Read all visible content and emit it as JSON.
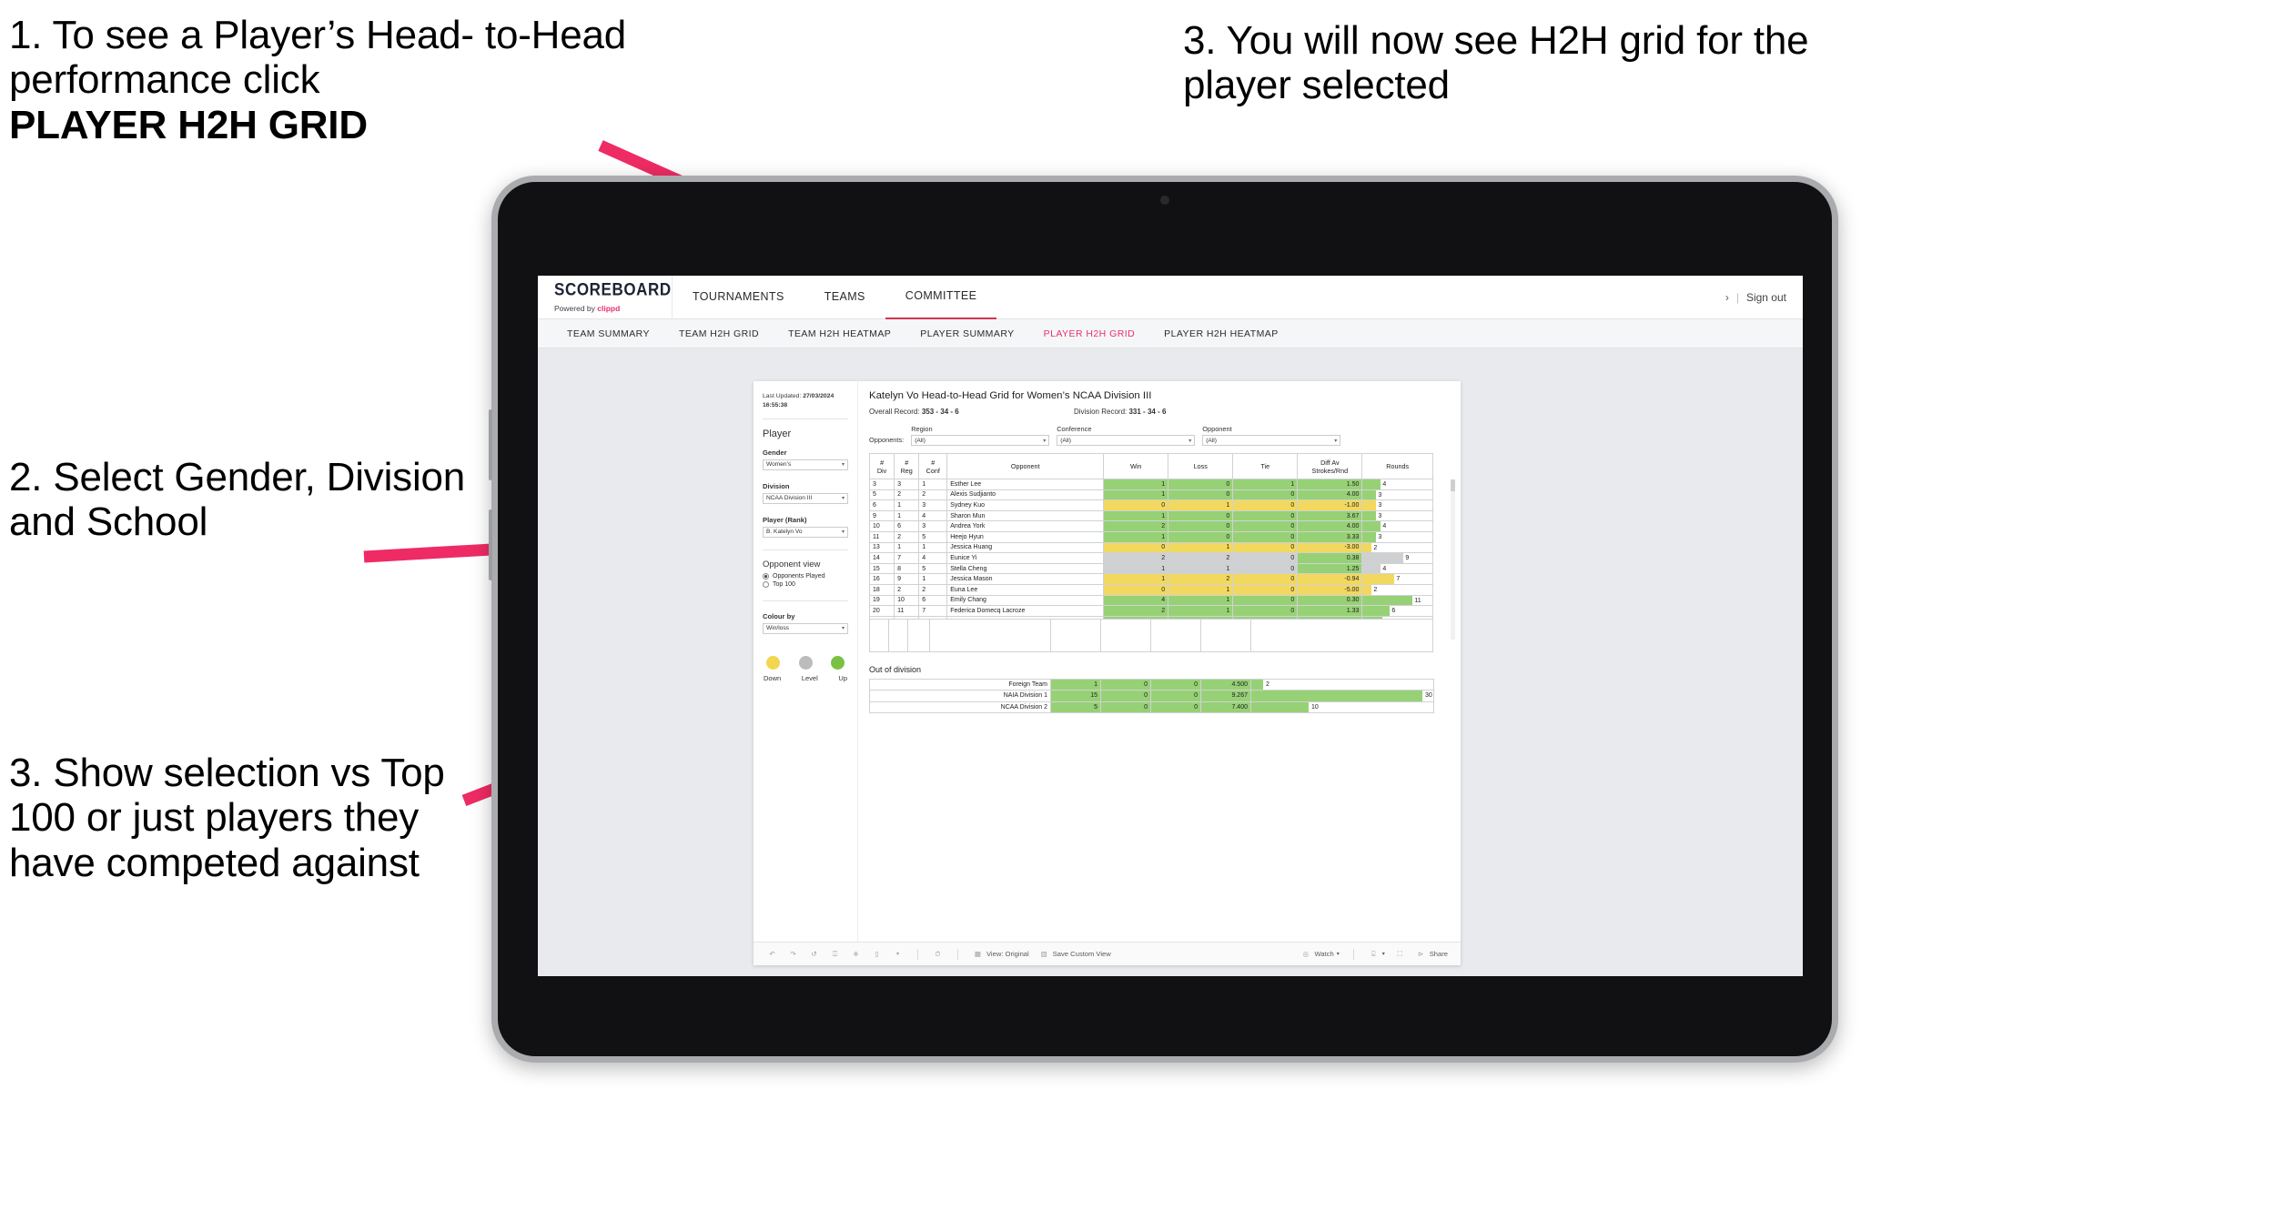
{
  "annotations": {
    "a1_line1": "1. To see a Player’s Head-",
    "a1_line2": "to-Head performance click",
    "a1_bold": "PLAYER H2H GRID",
    "a2": "2. Select Gender, Division and School",
    "a3": "3. Show selection vs Top 100 or just players they have competed against",
    "a4": "3. You will now see H2H grid for the player selected"
  },
  "app": {
    "brand": {
      "name": "SCOREBOARD",
      "sub_prefix": "Powered by ",
      "sub_accent": "clippd"
    },
    "topnav": [
      {
        "label": "TOURNAMENTS",
        "active": false
      },
      {
        "label": "TEAMS",
        "active": false
      },
      {
        "label": "COMMITTEE",
        "active": true
      }
    ],
    "header_right": {
      "chevron": "›",
      "sep": "|",
      "signout": "Sign out"
    },
    "subnav": [
      {
        "label": "TEAM SUMMARY",
        "active": false
      },
      {
        "label": "TEAM H2H GRID",
        "active": false
      },
      {
        "label": "TEAM H2H HEATMAP",
        "active": false
      },
      {
        "label": "PLAYER SUMMARY",
        "active": false
      },
      {
        "label": "PLAYER H2H GRID",
        "active": true
      },
      {
        "label": "PLAYER H2H HEATMAP",
        "active": false
      }
    ]
  },
  "filters": {
    "last_updated_label": "Last Updated:",
    "last_updated_value": "27/03/2024 16:55:38",
    "section_title": "Player",
    "gender": {
      "label": "Gender",
      "value": "Women’s"
    },
    "division": {
      "label": "Division",
      "value": "NCAA Division III"
    },
    "player": {
      "label": "Player (Rank)",
      "value": "B. Katelyn Vo"
    },
    "opponent_view": {
      "title": "Opponent view",
      "options": [
        {
          "label": "Opponents Played",
          "selected": true
        },
        {
          "label": "Top 100",
          "selected": false
        }
      ]
    },
    "colour_by": {
      "label": "Colour by",
      "value": "Win/loss"
    },
    "legend": [
      {
        "label": "Down",
        "color": "#f2d650"
      },
      {
        "label": "Level",
        "color": "#bcbcbc"
      },
      {
        "label": "Up",
        "color": "#7ac143"
      }
    ]
  },
  "workbook": {
    "title": "Katelyn Vo Head-to-Head Grid for Women’s NCAA Division III",
    "overall_record_label": "Overall Record:",
    "overall_record_value": "353 - 34 - 6",
    "division_record_label": "Division Record:",
    "division_record_value": "331 - 34 - 6",
    "opponents_label": "Opponents:",
    "opponent_filters": [
      {
        "label": "Region",
        "value": "(All)"
      },
      {
        "label": "Conference",
        "value": "(All)"
      },
      {
        "label": "Opponent",
        "value": "(All)"
      }
    ],
    "columns": [
      "# Div",
      "# Reg",
      "# Conf",
      "Opponent",
      "Win",
      "Loss",
      "Tie",
      "Diff Av Strokes/Rnd",
      "Rounds"
    ],
    "column_lines": [
      [
        "#",
        "Div"
      ],
      [
        "#",
        "Reg"
      ],
      [
        "#",
        "Conf"
      ],
      [
        "Opponent",
        ""
      ],
      [
        "Win",
        ""
      ],
      [
        "Loss",
        ""
      ],
      [
        "Tie",
        ""
      ],
      [
        "Diff Av",
        "Strokes/Rnd"
      ],
      [
        "Rounds",
        ""
      ]
    ],
    "out_of_division_title": "Out of division"
  },
  "toolbar": {
    "view_label": "View: Original",
    "save_label": "Save Custom View",
    "watch_label": "Watch",
    "share_label": "Share"
  },
  "chart_data": {
    "type": "table",
    "title": "Katelyn Vo Head-to-Head Grid for Women’s NCAA Division III",
    "columns": [
      "# Div",
      "# Reg",
      "# Conf",
      "Opponent",
      "Win",
      "Loss",
      "Tie",
      "Diff Av Strokes/Rnd",
      "Rounds"
    ],
    "rounds_max": 12,
    "rows": [
      {
        "div": "3",
        "reg": "3",
        "conf": "1",
        "opponent": "Esther Lee",
        "win": "1",
        "loss": "0",
        "tie": "1",
        "diff": "1.50",
        "rounds": 4,
        "state": "g"
      },
      {
        "div": "5",
        "reg": "2",
        "conf": "2",
        "opponent": "Alexis Sudjianto",
        "win": "1",
        "loss": "0",
        "tie": "0",
        "diff": "4.00",
        "rounds": 3,
        "state": "g"
      },
      {
        "div": "6",
        "reg": "1",
        "conf": "3",
        "opponent": "Sydney Kuo",
        "win": "0",
        "loss": "1",
        "tie": "0",
        "diff": "-1.00",
        "rounds": 3,
        "state": "y"
      },
      {
        "div": "9",
        "reg": "1",
        "conf": "4",
        "opponent": "Sharon Mun",
        "win": "1",
        "loss": "0",
        "tie": "0",
        "diff": "3.67",
        "rounds": 3,
        "state": "g"
      },
      {
        "div": "10",
        "reg": "6",
        "conf": "3",
        "opponent": "Andrea York",
        "win": "2",
        "loss": "0",
        "tie": "0",
        "diff": "4.00",
        "rounds": 4,
        "state": "g"
      },
      {
        "div": "11",
        "reg": "2",
        "conf": "5",
        "opponent": "Heejo Hyun",
        "win": "1",
        "loss": "0",
        "tie": "0",
        "diff": "3.33",
        "rounds": 3,
        "state": "g"
      },
      {
        "div": "13",
        "reg": "1",
        "conf": "1",
        "opponent": "Jessica Huang",
        "win": "0",
        "loss": "1",
        "tie": "0",
        "diff": "-3.00",
        "rounds": 2,
        "state": "y"
      },
      {
        "div": "14",
        "reg": "7",
        "conf": "4",
        "opponent": "Eunice Yi",
        "win": "2",
        "loss": "2",
        "tie": "0",
        "diff": "0.38",
        "rounds": 9,
        "state": "n",
        "diff_state": "g"
      },
      {
        "div": "15",
        "reg": "8",
        "conf": "5",
        "opponent": "Stella Cheng",
        "win": "1",
        "loss": "1",
        "tie": "0",
        "diff": "1.25",
        "rounds": 4,
        "state": "n",
        "diff_state": "g"
      },
      {
        "div": "16",
        "reg": "9",
        "conf": "1",
        "opponent": "Jessica Mason",
        "win": "1",
        "loss": "2",
        "tie": "0",
        "diff": "-0.94",
        "rounds": 7,
        "state": "y"
      },
      {
        "div": "18",
        "reg": "2",
        "conf": "2",
        "opponent": "Euna Lee",
        "win": "0",
        "loss": "1",
        "tie": "0",
        "diff": "-5.00",
        "rounds": 2,
        "state": "y"
      },
      {
        "div": "19",
        "reg": "10",
        "conf": "6",
        "opponent": "Emily Chang",
        "win": "4",
        "loss": "1",
        "tie": "0",
        "diff": "0.30",
        "rounds": 11,
        "state": "g"
      },
      {
        "div": "20",
        "reg": "11",
        "conf": "7",
        "opponent": "Federica Domecq Lacroze",
        "win": "2",
        "loss": "1",
        "tie": "0",
        "diff": "1.33",
        "rounds": 6,
        "state": "g"
      }
    ],
    "out_of_division": {
      "rounds_max": 32,
      "rows": [
        {
          "name": "Foreign Team",
          "win": "1",
          "loss": "0",
          "tie": "0",
          "diff": "4.500",
          "rounds": 2,
          "state": "g"
        },
        {
          "name": "NAIA Division 1",
          "win": "15",
          "loss": "0",
          "tie": "0",
          "diff": "9.267",
          "rounds": 30,
          "state": "g"
        },
        {
          "name": "NCAA Division 2",
          "win": "5",
          "loss": "0",
          "tie": "0",
          "diff": "7.400",
          "rounds": 10,
          "state": "g"
        }
      ]
    }
  }
}
